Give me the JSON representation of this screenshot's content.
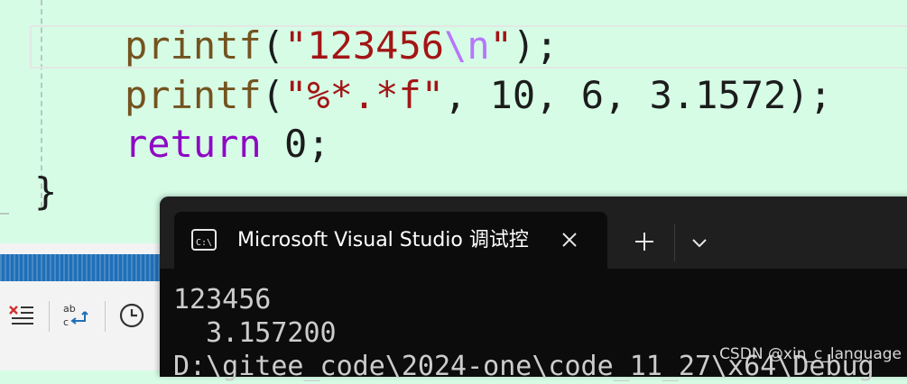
{
  "editor": {
    "lines": [
      {
        "fn": "printf",
        "open": "(",
        "str": "\"123456",
        "esc": "\\n",
        "strEnd": "\"",
        "close": ");"
      },
      {
        "fn": "printf",
        "open": "(",
        "str": "\"%*.*f\"",
        "args": ", 10, 6, 3.1572",
        "close": ");"
      },
      {
        "kw": "return",
        "space": " ",
        "num": "0",
        "end": ";"
      },
      {
        "brace": "}"
      }
    ]
  },
  "terminal": {
    "tab_title": "Microsoft Visual Studio 调试控",
    "icons": {
      "tab": "terminal-icon",
      "close": "close-icon",
      "new_tab": "plus-icon",
      "dropdown": "chevron-down-icon"
    },
    "output": [
      "123456",
      "  3.157200",
      "D:\\gitee_code\\2024-one\\code_11_27\\x64\\Debug"
    ]
  },
  "toolbar": {
    "icons": [
      "list-clear-icon",
      "replace-text-icon",
      "clock-icon"
    ]
  },
  "watermark": "CSDN @xin_c_language",
  "colors": {
    "editor_bg": "#d6fce6",
    "terminal_bg": "#0c0c0c",
    "titlebar_bg": "#1f1f1f",
    "accent_blue": "#1f6fb8"
  }
}
